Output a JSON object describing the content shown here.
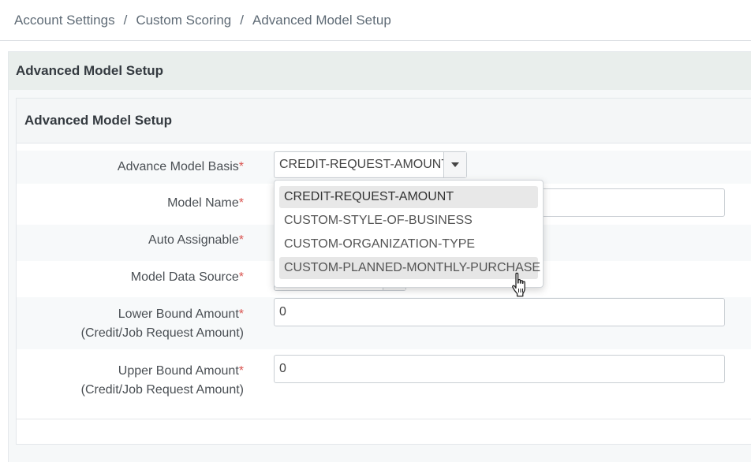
{
  "breadcrumb": {
    "items": [
      "Account Settings",
      "Custom Scoring",
      "Advanced Model Setup"
    ],
    "separator": "/"
  },
  "outer_panel": {
    "title": "Advanced Model Setup"
  },
  "inner_panel": {
    "title": "Advanced Model Setup"
  },
  "form": {
    "required_marker": "*",
    "advance_model_basis": {
      "label": "Advance Model Basis",
      "value": "CREDIT-REQUEST-AMOUNT"
    },
    "model_name": {
      "label": "Model Name",
      "value": ""
    },
    "auto_assignable": {
      "label": "Auto Assignable"
    },
    "model_data_source": {
      "label": "Model Data Source"
    },
    "lower_bound": {
      "label": "Lower Bound Amount",
      "sublabel": "(Credit/Job Request Amount)",
      "value": "0"
    },
    "upper_bound": {
      "label": "Upper Bound Amount",
      "sublabel": "(Credit/Job Request Amount)",
      "value": "0"
    }
  },
  "dropdown": {
    "options": [
      "CREDIT-REQUEST-AMOUNT",
      "CUSTOM-STYLE-OF-BUSINESS",
      "CUSTOM-ORGANIZATION-TYPE",
      "CUSTOM-PLANNED-MONTHLY-PURCHASE"
    ],
    "selected_index": 0,
    "hover_index": 3
  },
  "colors": {
    "required": "#d9534f",
    "panel_header": "#e9eeec",
    "selected_option": "#e8e8e8"
  },
  "icons": {
    "caret": "caret-down-icon",
    "cursor": "hand-pointer-icon"
  }
}
